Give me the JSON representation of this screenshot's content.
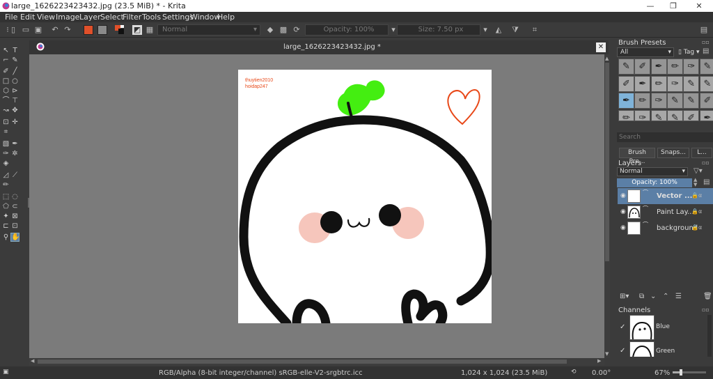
{
  "window": {
    "title": "large_1626223423432.jpg (23.5 MiB)  * - Krita",
    "minimize_glyph": "—",
    "maximize_glyph": "❐",
    "close_glyph": "✕"
  },
  "menu": [
    "File",
    "Edit",
    "View",
    "Image",
    "Layer",
    "Select",
    "Filter",
    "Tools",
    "Settings",
    "Window",
    "Help"
  ],
  "toolbar": {
    "blend_mode": "Normal",
    "opacity": "Opacity: 100%",
    "size": "Size: 7.50 px",
    "fg_color": "#e0502a",
    "bg_color": "#8a8a8a"
  },
  "document": {
    "tab_title": "large_1626223423432.jpg *",
    "close_glyph": "✕",
    "watermark_line1": "thuytien2010",
    "watermark_line2": "hoidap247",
    "sprout_color": "#44ee11",
    "heart_color": "#e84818",
    "cheek_color": "#f6c6bc"
  },
  "brush_presets": {
    "title": "Brush Presets",
    "filter": "All",
    "tag_label": "Tag",
    "search_placeholder": "Search",
    "tabs": [
      "Brush Pre...",
      "Snaps...",
      "L..."
    ]
  },
  "layers": {
    "title": "Layers",
    "blend_mode": "Normal",
    "opacity": "Opacity:  100%",
    "items": [
      {
        "name": "Vector ...",
        "selected": true
      },
      {
        "name": "Paint Lay...",
        "selected": false
      },
      {
        "name": "background",
        "selected": false
      }
    ]
  },
  "channels": {
    "title": "Channels",
    "items": [
      "Blue",
      "Green"
    ]
  },
  "status": {
    "color_model": "RGB/Alpha (8-bit integer/channel)  sRGB-elle-V2-srgbtrc.icc",
    "dimensions": "1,024 x 1,024 (23.5 MiB)",
    "rotation": "0.00°",
    "zoom": "67%"
  }
}
